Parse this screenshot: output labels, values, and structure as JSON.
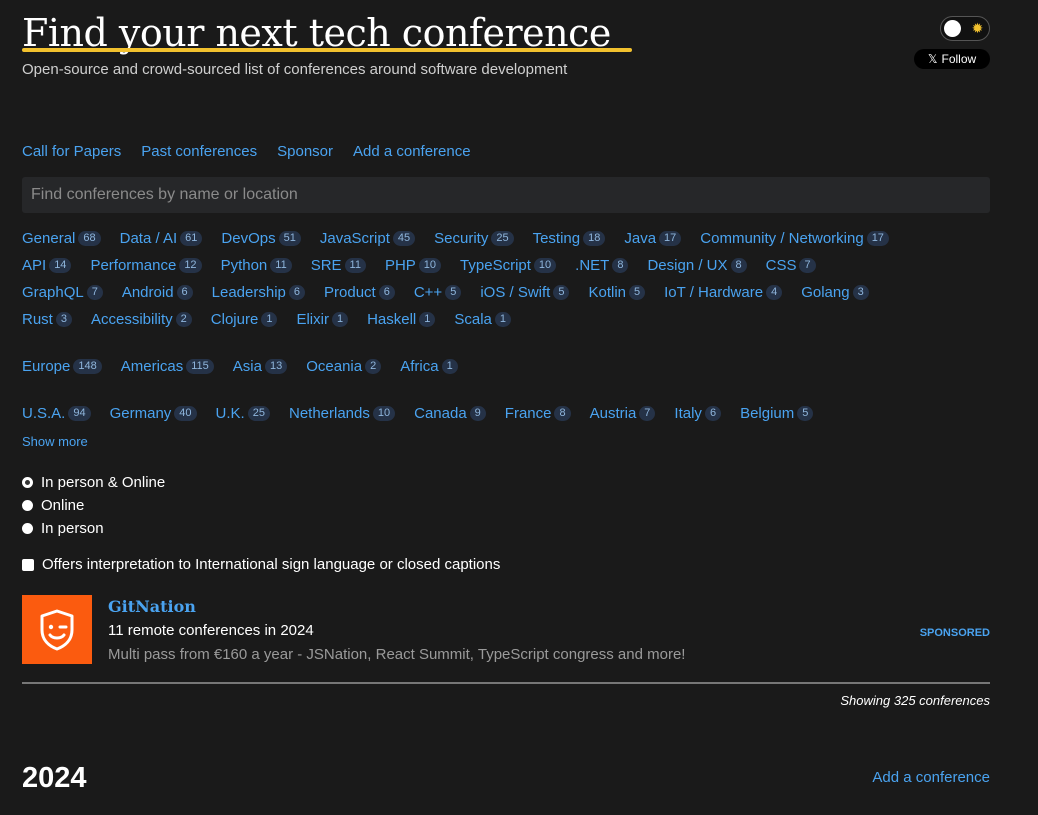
{
  "header": {
    "title": "Find your next tech conference",
    "subtitle": "Open-source and crowd-sourced list of conferences around software development",
    "follow_label": "Follow",
    "follow_icon": "x-logo-icon"
  },
  "nav": [
    "Call for Papers",
    "Past conferences",
    "Sponsor",
    "Add a conference"
  ],
  "search": {
    "placeholder": "Find conferences by name or location"
  },
  "topics": [
    [
      [
        "General",
        "68"
      ],
      [
        "Data / AI",
        "61"
      ],
      [
        "DevOps",
        "51"
      ],
      [
        "JavaScript",
        "45"
      ],
      [
        "Security",
        "25"
      ],
      [
        "Testing",
        "18"
      ],
      [
        "Java",
        "17"
      ],
      [
        "Community / Networking",
        "17"
      ]
    ],
    [
      [
        "API",
        "14"
      ],
      [
        "Performance",
        "12"
      ],
      [
        "Python",
        "11"
      ],
      [
        "SRE",
        "11"
      ],
      [
        "PHP",
        "10"
      ],
      [
        "TypeScript",
        "10"
      ],
      [
        ".NET",
        "8"
      ],
      [
        "Design / UX",
        "8"
      ],
      [
        "CSS",
        "7"
      ]
    ],
    [
      [
        "GraphQL",
        "7"
      ],
      [
        "Android",
        "6"
      ],
      [
        "Leadership",
        "6"
      ],
      [
        "Product",
        "6"
      ],
      [
        "C++",
        "5"
      ],
      [
        "iOS / Swift",
        "5"
      ],
      [
        "Kotlin",
        "5"
      ],
      [
        "IoT / Hardware",
        "4"
      ],
      [
        "Golang",
        "3"
      ]
    ],
    [
      [
        "Rust",
        "3"
      ],
      [
        "Accessibility",
        "2"
      ],
      [
        "Clojure",
        "1"
      ],
      [
        "Elixir",
        "1"
      ],
      [
        "Haskell",
        "1"
      ],
      [
        "Scala",
        "1"
      ]
    ]
  ],
  "regions": [
    [
      "Europe",
      "148"
    ],
    [
      "Americas",
      "115"
    ],
    [
      "Asia",
      "13"
    ],
    [
      "Oceania",
      "2"
    ],
    [
      "Africa",
      "1"
    ]
  ],
  "countries": [
    [
      "U.S.A.",
      "94"
    ],
    [
      "Germany",
      "40"
    ],
    [
      "U.K.",
      "25"
    ],
    [
      "Netherlands",
      "10"
    ],
    [
      "Canada",
      "9"
    ],
    [
      "France",
      "8"
    ],
    [
      "Austria",
      "7"
    ],
    [
      "Italy",
      "6"
    ],
    [
      "Belgium",
      "5"
    ]
  ],
  "show_more": "Show more",
  "format_options": [
    "In person & Online",
    "Online",
    "In person"
  ],
  "format_selected": 0,
  "accessibility_filter": "Offers interpretation to International sign language or closed captions",
  "sponsor": {
    "name": "GitNation",
    "headline": "11 remote conferences in 2024",
    "description": "Multi pass from €160 a year - JSNation, React Summit, TypeScript congress and more!",
    "badge": "SPONSORED"
  },
  "results": {
    "showing": "Showing 325 conferences"
  },
  "year_section": {
    "year": "2024",
    "add_link": "Add a conference"
  },
  "colors": {
    "accent": "#4aa3f0",
    "highlight": "#f2c12e",
    "sponsor_bg": "#fb5b0f",
    "background": "#1a1a1a"
  }
}
